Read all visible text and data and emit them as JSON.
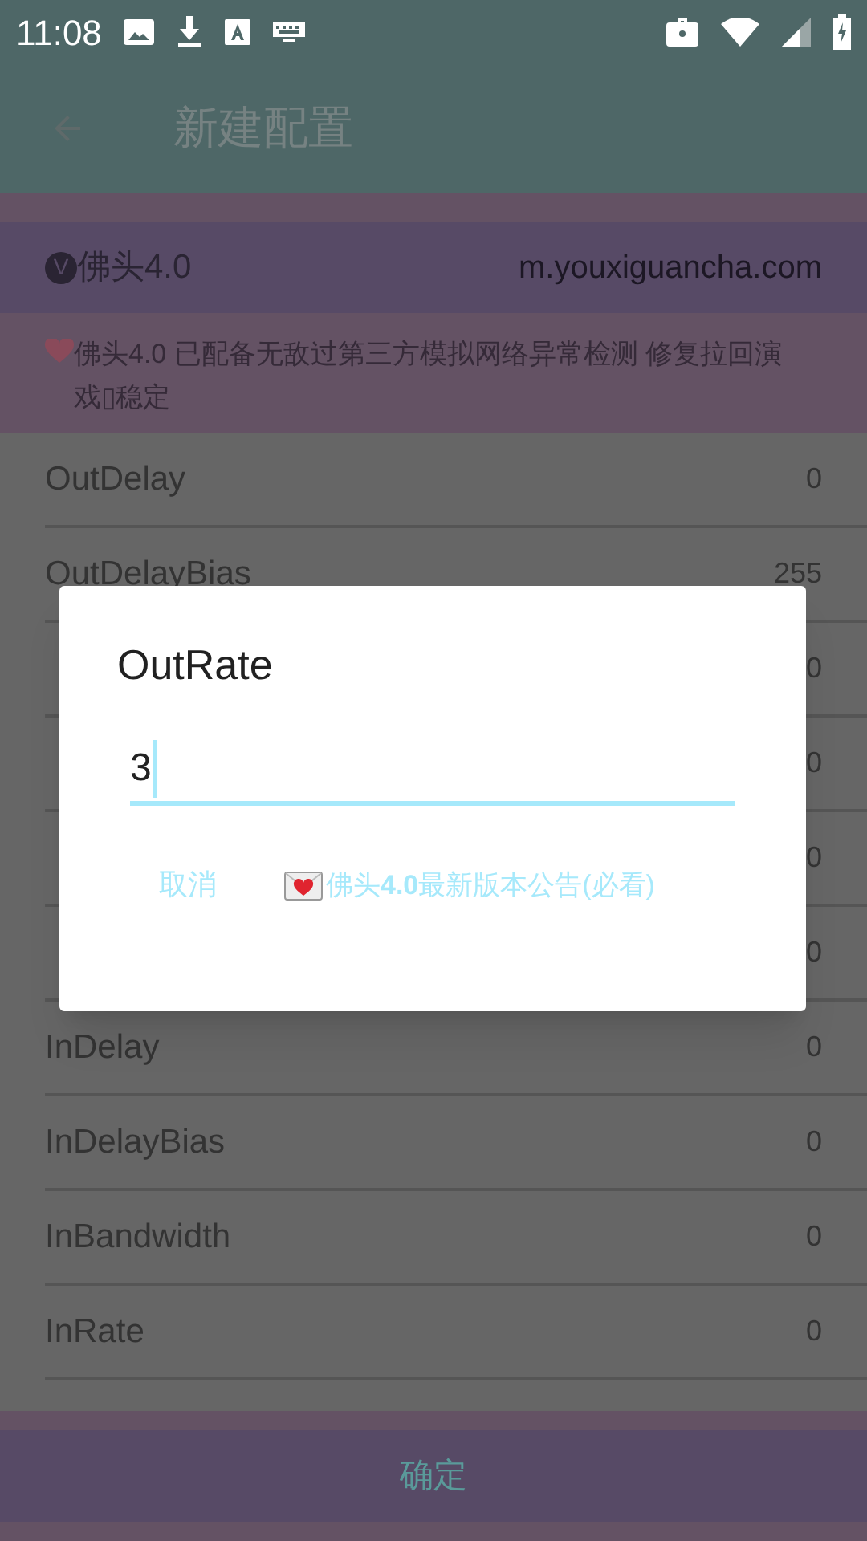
{
  "status_bar": {
    "time": "11:08"
  },
  "app_bar": {
    "title": "新建配置"
  },
  "header": {
    "name": "佛头4.0",
    "badge": "V",
    "site": "m.youxiguancha.com"
  },
  "notice": {
    "text": "佛头4.0 已配备无敌过第三方模拟网络异常检测 修复拉回演戏▯稳定"
  },
  "settings": [
    {
      "label": "OutDelay",
      "value": "0"
    },
    {
      "label": "OutDelayBias",
      "value": "255"
    },
    {
      "value": "0"
    },
    {
      "value": "0"
    },
    {
      "value": "0"
    },
    {
      "value": "0"
    },
    {
      "label": "InDelay",
      "value": "0"
    },
    {
      "label": "InDelayBias",
      "value": "0"
    },
    {
      "label": "InBandwidth",
      "value": "0"
    },
    {
      "label": "InRate",
      "value": "0"
    }
  ],
  "confirm_button": "确定",
  "dialog": {
    "title": "OutRate",
    "value": "3",
    "buttons": [
      {
        "kind": "text",
        "label": "取消"
      },
      {
        "kind": "mail",
        "label": "佛头**4.0**最新版本公告(必看)"
      }
    ]
  }
}
